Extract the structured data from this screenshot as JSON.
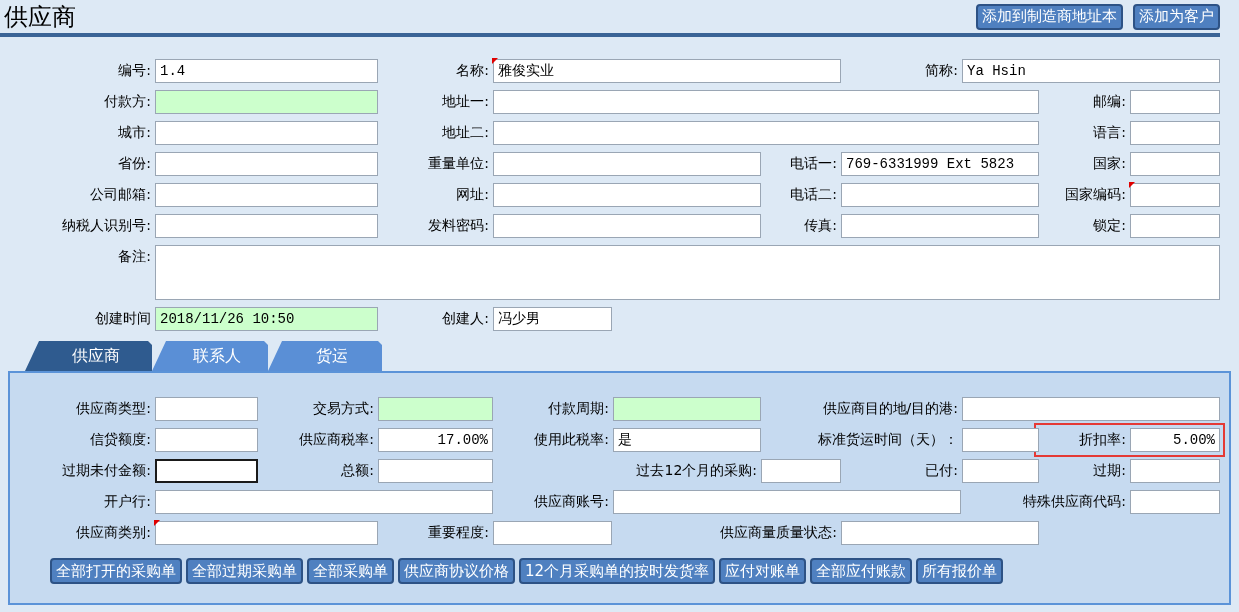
{
  "title": "供应商",
  "header_buttons": [
    "添加到制造商地址本",
    "添加为客户"
  ],
  "form_rows": [
    [
      {
        "label": "编号:",
        "value": "1.4",
        "kind": "text",
        "shaded": false,
        "flag": false
      },
      {
        "label": "名称:",
        "value": "雅俊实业",
        "kind": "text",
        "shaded": false,
        "flag": true
      },
      {
        "label": "简称:",
        "value": "Ya Hsin",
        "kind": "text",
        "shaded": false,
        "flag": false
      }
    ],
    [
      {
        "label": "付款方:",
        "kind": "text",
        "shaded": true,
        "flag": false
      },
      {
        "label": "地址一:",
        "kind": "text",
        "shaded": false,
        "flag": false
      },
      {
        "label": "邮编:",
        "kind": "text",
        "shaded": false,
        "flag": false
      }
    ],
    [
      {
        "label": "城市:",
        "kind": "text",
        "shaded": false,
        "flag": false
      },
      {
        "label": "地址二:",
        "kind": "text",
        "shaded": false,
        "flag": false
      },
      {
        "label": "语言:",
        "kind": "text",
        "shaded": false,
        "flag": false
      }
    ],
    [
      {
        "label": "省份:",
        "kind": "text",
        "shaded": false,
        "flag": false
      },
      {
        "label": "重量单位:",
        "kind": "text",
        "shaded": false,
        "flag": false
      },
      {
        "label": "电话一:",
        "value": "769-6331999 Ext 5823",
        "kind": "text",
        "shaded": false,
        "flag": false
      },
      {
        "label": "国家:",
        "kind": "text",
        "shaded": false,
        "flag": false
      }
    ],
    [
      {
        "label": "公司邮箱:",
        "kind": "text",
        "shaded": false,
        "flag": false
      },
      {
        "label": "网址:",
        "kind": "text",
        "shaded": false,
        "flag": false
      },
      {
        "label": "电话二:",
        "kind": "text",
        "shaded": false,
        "flag": false
      },
      {
        "label": "国家编码:",
        "kind": "text",
        "shaded": false,
        "flag": true
      }
    ],
    [
      {
        "label": "纳税人识别号:",
        "kind": "text",
        "shaded": false,
        "flag": false
      },
      {
        "label": "发料密码:",
        "kind": "text",
        "shaded": false,
        "flag": false
      },
      {
        "label": "传真:",
        "kind": "text",
        "shaded": false,
        "flag": false
      },
      {
        "label": "锁定:",
        "kind": "text",
        "shaded": false,
        "flag": false
      }
    ],
    [
      {
        "label": "备注:",
        "kind": "textarea",
        "shaded": false,
        "flag": false
      }
    ],
    [
      {
        "label": "创建时间",
        "value": "2018/11/26 10:50",
        "kind": "text",
        "shaded": true,
        "flag": false
      },
      {
        "label": "创建人:",
        "value": "冯少男",
        "kind": "text",
        "shaded": false,
        "flag": false
      }
    ]
  ],
  "tabs": [
    {
      "label": "供应商",
      "selected": true
    },
    {
      "label": "联系人",
      "selected": false
    },
    {
      "label": "货运",
      "selected": false
    }
  ],
  "panel_rows": [
    [
      {
        "label": "供应商类型:",
        "kind": "text",
        "shaded": false,
        "flag": false,
        "focused": false,
        "highlighted": false
      },
      {
        "label": "交易方式:",
        "kind": "text",
        "shaded": true,
        "flag": false,
        "focused": false,
        "highlighted": false
      },
      {
        "label": "付款周期:",
        "kind": "text",
        "shaded": true,
        "flag": false,
        "focused": false,
        "highlighted": false
      },
      {
        "label": "供应商目的地/目的港:",
        "kind": "text",
        "shaded": false,
        "flag": false,
        "focused": false,
        "highlighted": false
      }
    ],
    [
      {
        "label": "信贷额度:",
        "kind": "text",
        "shaded": false,
        "flag": false,
        "focused": false,
        "highlighted": false
      },
      {
        "label": "供应商税率:",
        "value": "17.00%",
        "kind": "number",
        "shaded": false,
        "flag": false,
        "focused": false,
        "highlighted": false
      },
      {
        "label": "使用此税率:",
        "value": "是",
        "kind": "text",
        "shaded": false,
        "flag": false,
        "focused": false,
        "highlighted": false
      },
      {
        "label": "标准货运时间（天）：",
        "kind": "text",
        "shaded": false,
        "flag": false,
        "focused": false,
        "highlighted": false
      },
      {
        "label": "折扣率:",
        "value": "5.00%",
        "kind": "number",
        "shaded": false,
        "flag": false,
        "focused": false,
        "highlighted": true
      }
    ],
    [
      {
        "label": "过期未付金额:",
        "kind": "text",
        "shaded": false,
        "flag": false,
        "focused": true,
        "highlighted": false
      },
      {
        "label": "总额:",
        "kind": "text",
        "shaded": false,
        "flag": false,
        "focused": false,
        "highlighted": false
      },
      {
        "label": "过去12个月的采购:",
        "kind": "text",
        "shaded": false,
        "flag": false,
        "focused": false,
        "highlighted": false
      },
      {
        "label": "已付:",
        "kind": "text",
        "shaded": false,
        "flag": false,
        "focused": false,
        "highlighted": false
      },
      {
        "label": "过期:",
        "kind": "text",
        "shaded": false,
        "flag": false,
        "focused": false,
        "highlighted": false
      }
    ],
    [
      {
        "label": "开户行:",
        "kind": "text",
        "shaded": false,
        "flag": false,
        "focused": false,
        "highlighted": false
      },
      {
        "label": "供应商账号:",
        "kind": "text",
        "shaded": false,
        "flag": false,
        "focused": false,
        "highlighted": false
      },
      {
        "label": "特殊供应商代码:",
        "kind": "text",
        "shaded": false,
        "flag": false,
        "focused": false,
        "highlighted": false
      }
    ],
    [
      {
        "label": "供应商类别:",
        "kind": "text",
        "shaded": false,
        "flag": true,
        "focused": false,
        "highlighted": false
      },
      {
        "label": "重要程度:",
        "kind": "text",
        "shaded": false,
        "flag": false,
        "focused": false,
        "highlighted": false
      },
      {
        "label": "供应商量质量状态:",
        "kind": "text",
        "shaded": false,
        "flag": false,
        "focused": false,
        "highlighted": false
      }
    ]
  ],
  "panel_buttons": [
    "全部打开的采购单",
    "全部过期采购单",
    "全部采购单",
    "供应商协议价格",
    "12个月采购单的按时发货率",
    "应付对账单",
    "全部应付账款",
    "所有报价单"
  ]
}
